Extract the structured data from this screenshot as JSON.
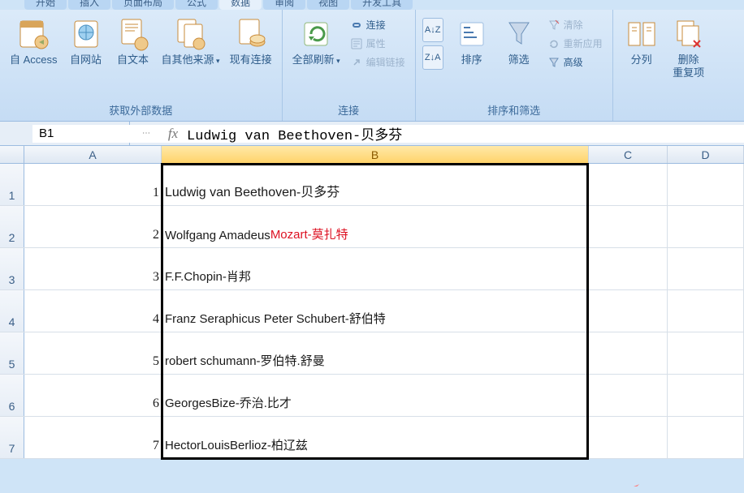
{
  "tabs": {
    "t1": "开始",
    "t2": "插入",
    "t3": "页面布局",
    "t4": "公式",
    "t5": "数据",
    "t6": "审阅",
    "t7": "视图",
    "t8": "开发工具"
  },
  "ribbon": {
    "ext": {
      "access": "自 Access",
      "web": "自网站",
      "text": "自文本",
      "other": "自其他来源",
      "existing": "现有连接",
      "grouplabel": "获取外部数据"
    },
    "conn": {
      "refresh": "全部刷新",
      "connections": "连接",
      "properties": "属性",
      "editlinks": "编辑链接",
      "grouplabel": "连接"
    },
    "sort": {
      "az": "A↓Z",
      "za": "Z↓A",
      "sort": "排序",
      "filter": "筛选",
      "clear": "清除",
      "reapply": "重新应用",
      "advanced": "高级",
      "grouplabel": "排序和筛选"
    },
    "tools": {
      "texttocols": "分列",
      "removedup": "删除\n重复项"
    }
  },
  "formula": {
    "namebox": "B1",
    "fx": "Ludwig van Beethoven-贝多芬"
  },
  "cols": {
    "A": "A",
    "B": "B",
    "C": "C",
    "D": "D"
  },
  "rows": [
    {
      "n": "1",
      "a": "1",
      "b": "Ludwig van Beethoven-贝多芬",
      "b_red": ""
    },
    {
      "n": "2",
      "a": "2",
      "b": "Wolfgang Amadeus ",
      "b_red": "Mozart-莫扎特"
    },
    {
      "n": "3",
      "a": "3",
      "b": "F.F.Chopin-肖邦",
      "b_red": ""
    },
    {
      "n": "4",
      "a": "4",
      "b": "Franz Seraphicus Peter Schubert-舒伯特",
      "b_red": ""
    },
    {
      "n": "5",
      "a": "5",
      "b": "robert schumann-罗伯特.舒曼",
      "b_red": ""
    },
    {
      "n": "6",
      "a": "6",
      "b": "GeorgesBize-乔治.比才",
      "b_red": ""
    },
    {
      "n": "7",
      "a": "7",
      "b": "HectorLouisBerlioz-柏辽兹",
      "b_red": ""
    }
  ]
}
